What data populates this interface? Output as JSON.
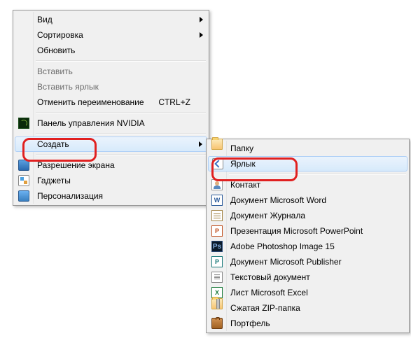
{
  "main_menu": {
    "view": "Вид",
    "sort": "Сортировка",
    "refresh": "Обновить",
    "paste": "Вставить",
    "paste_shortcut": "Вставить ярлык",
    "undo_rename": "Отменить переименование",
    "undo_shortcut": "CTRL+Z",
    "nvidia": "Панель управления NVIDIA",
    "create": "Создать",
    "resolution": "Разрешение экрана",
    "gadgets": "Гаджеты",
    "personalize": "Персонализация"
  },
  "sub_menu": {
    "folder": "Папку",
    "shortcut": "Ярлык",
    "contact": "Контакт",
    "word": "Документ Microsoft Word",
    "journal": "Документ Журнала",
    "ppt": "Презентация Microsoft PowerPoint",
    "ps": "Adobe Photoshop Image 15",
    "pub": "Документ Microsoft Publisher",
    "txt": "Текстовый документ",
    "excel": "Лист Microsoft Excel",
    "zip": "Сжатая ZIP-папка",
    "portfolio": "Портфель"
  }
}
